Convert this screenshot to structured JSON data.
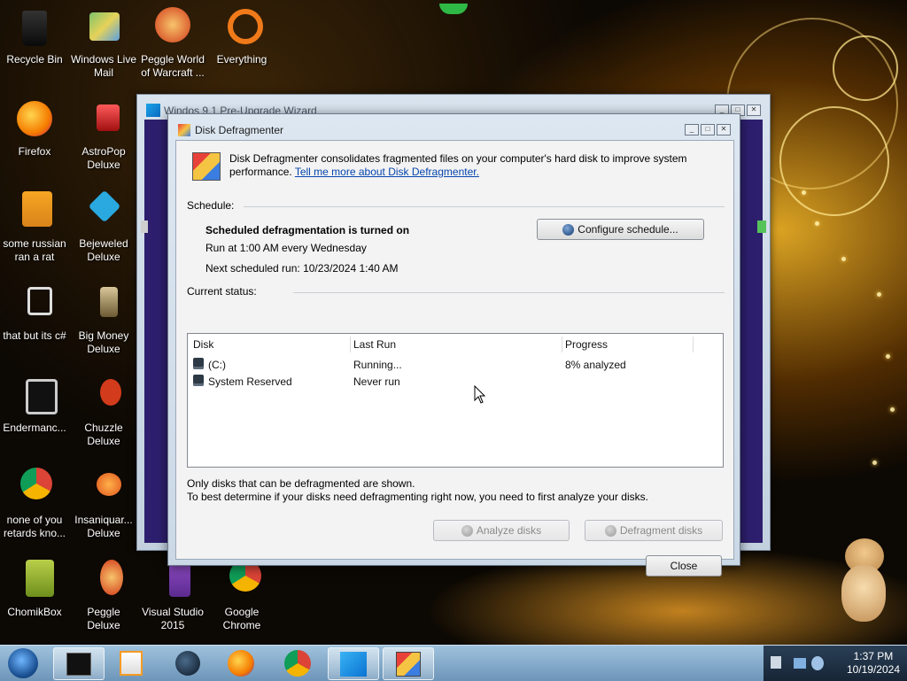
{
  "desktop": {
    "icons": [
      {
        "label": "Recycle Bin",
        "icon": "recycle-bin-icon"
      },
      {
        "label": "Windows Live Mail",
        "icon": "mail-icon"
      },
      {
        "label": "Peggle World of Warcraft ...",
        "icon": "peggle-icon"
      },
      {
        "label": "Everything",
        "icon": "search-icon"
      },
      {
        "label": "Firefox",
        "icon": "firefox-icon"
      },
      {
        "label": "AstroPop Deluxe",
        "icon": "game-icon"
      },
      {
        "label": "some russian ran a rat",
        "icon": "ie-icon"
      },
      {
        "label": "Bejeweled Deluxe",
        "icon": "gem-icon"
      },
      {
        "label": "that but its c#",
        "icon": "shortcut-icon"
      },
      {
        "label": "Big Money Deluxe",
        "icon": "game-icon"
      },
      {
        "label": "Endermanc...",
        "icon": "terminal-icon"
      },
      {
        "label": "Chuzzle Deluxe",
        "icon": "game-icon"
      },
      {
        "label": "none of you retards kno...",
        "icon": "chrome-icon"
      },
      {
        "label": "Insaniquar... Deluxe",
        "icon": "fish-icon"
      },
      {
        "label": "ChomikBox",
        "icon": "hamster-icon"
      },
      {
        "label": "Peggle Deluxe",
        "icon": "peggle-icon"
      },
      {
        "label": "Visual Studio 2015",
        "icon": "visual-studio-icon"
      },
      {
        "label": "Google Chrome",
        "icon": "chrome-icon"
      }
    ]
  },
  "wizard": {
    "title": "Windos 9.1 Pre-Upgrade Wizard"
  },
  "dialog": {
    "title": "Disk Defragmenter",
    "intro": "Disk Defragmenter consolidates fragmented files on your computer's hard disk to improve system",
    "intro2": "performance.",
    "learn_link": "Tell me more about Disk Defragmenter.",
    "schedule": {
      "heading": "Schedule:",
      "state": "Scheduled defragmentation is turned on",
      "run_at": "Run at 1:00 AM every Wednesday",
      "next_run": "Next scheduled run: 10/23/2024 1:40 AM",
      "configure_label": "Configure schedule..."
    },
    "status": {
      "heading": "Current status:",
      "columns": [
        "Disk",
        "Last Run",
        "Progress"
      ],
      "rows": [
        {
          "disk": "(C:)",
          "last_run": "Running...",
          "progress": "8% analyzed"
        },
        {
          "disk": "System Reserved",
          "last_run": "Never run",
          "progress": ""
        }
      ]
    },
    "note1": "Only disks that can be defragmented are shown.",
    "note2": "To best determine if your disks need defragmenting right now, you need to first analyze your disks.",
    "analyze_label": "Analyze disks",
    "defrag_label": "Defragment disks",
    "close_label": "Close"
  },
  "taskbar": {
    "clock_time": "1:37 PM",
    "clock_date": "10/19/2024",
    "tasks": [
      "start-orb-icon",
      "terminal-icon",
      "media-player-icon",
      "globe-icon",
      "firefox-icon",
      "chrome-icon",
      "windows-logo-icon",
      "defrag-icon"
    ]
  },
  "colors": {
    "taskbar": "#7fa6c8",
    "dialog_body": "#f3f3f3",
    "link": "#0645ad",
    "wizard_body": "#2d1f6e"
  }
}
